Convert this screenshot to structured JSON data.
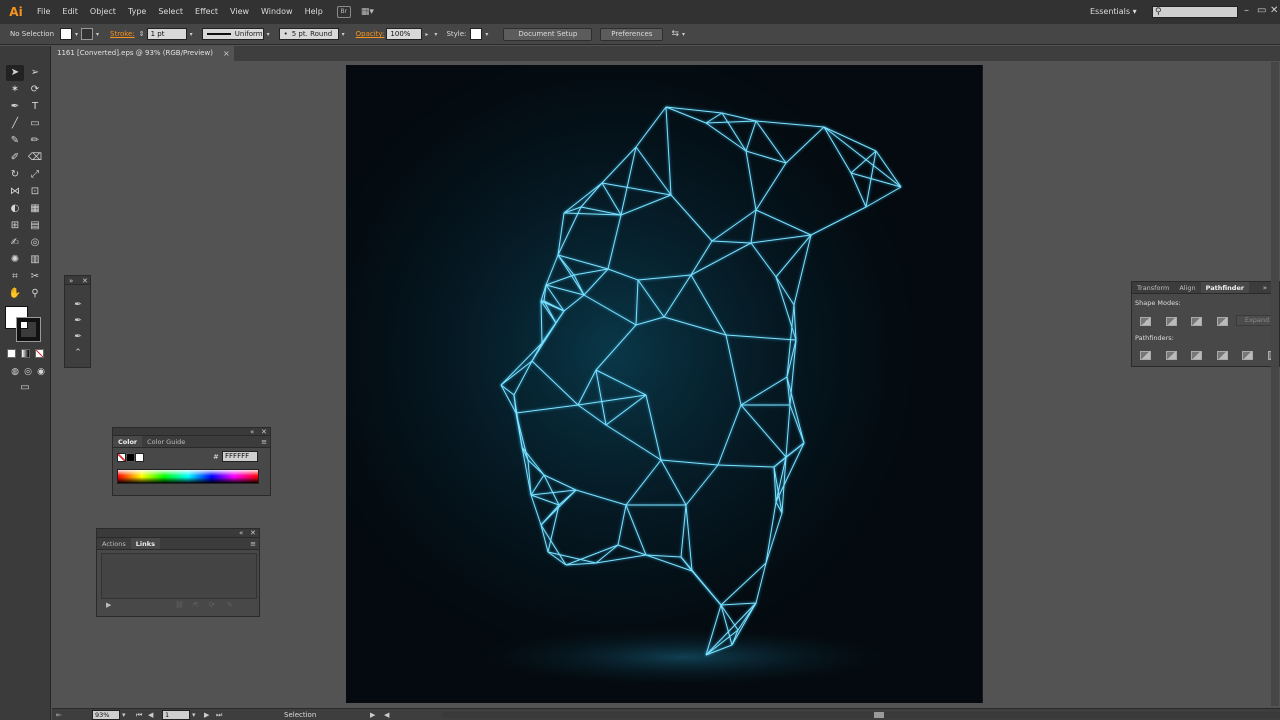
{
  "app": {
    "logo": "Ai"
  },
  "menus": [
    "File",
    "Edit",
    "Object",
    "Type",
    "Select",
    "Effect",
    "View",
    "Window",
    "Help"
  ],
  "menubar": {
    "bridge_label": "Br",
    "workspace": "Essentials",
    "workspace_arrow": "▾",
    "search_placeholder": "",
    "window_controls": [
      "–",
      "▭",
      "✕"
    ]
  },
  "controlbar": {
    "selection": "No Selection",
    "stroke_label": "Stroke:",
    "stroke_weight": "1 pt",
    "stroke_profile": "Uniform",
    "brush": "5 pt. Round",
    "opacity_label": "Opacity:",
    "opacity_value": "100%",
    "style_label": "Style:",
    "document_setup": "Document Setup",
    "preferences": "Preferences"
  },
  "document": {
    "tab_title": "1161 [Converted].eps @ 93% (RGB/Preview)",
    "close": "×"
  },
  "tools_panel": {
    "tools": [
      {
        "name": "selection-tool",
        "glyph": "➤"
      },
      {
        "name": "direct-selection-tool",
        "glyph": "➢"
      },
      {
        "name": "magic-wand-tool",
        "glyph": "✶"
      },
      {
        "name": "lasso-tool",
        "glyph": "⟳"
      },
      {
        "name": "pen-tool",
        "glyph": "✒"
      },
      {
        "name": "type-tool",
        "glyph": "T"
      },
      {
        "name": "line-tool",
        "glyph": "╱"
      },
      {
        "name": "rectangle-tool",
        "glyph": "▭"
      },
      {
        "name": "paintbrush-tool",
        "glyph": "✎"
      },
      {
        "name": "pencil-tool",
        "glyph": "✏"
      },
      {
        "name": "blob-brush-tool",
        "glyph": "✐"
      },
      {
        "name": "eraser-tool",
        "glyph": "⌫"
      },
      {
        "name": "rotate-tool",
        "glyph": "↻"
      },
      {
        "name": "scale-tool",
        "glyph": "⤢"
      },
      {
        "name": "width-tool",
        "glyph": "⋈"
      },
      {
        "name": "free-transform-tool",
        "glyph": "⊡"
      },
      {
        "name": "shape-builder-tool",
        "glyph": "◐"
      },
      {
        "name": "perspective-grid-tool",
        "glyph": "▦"
      },
      {
        "name": "mesh-tool",
        "glyph": "⊞"
      },
      {
        "name": "gradient-tool",
        "glyph": "▤"
      },
      {
        "name": "eyedropper-tool",
        "glyph": "✍"
      },
      {
        "name": "blend-tool",
        "glyph": "◎"
      },
      {
        "name": "symbol-sprayer-tool",
        "glyph": "✺"
      },
      {
        "name": "column-graph-tool",
        "glyph": "▥"
      },
      {
        "name": "artboard-tool",
        "glyph": "⌗"
      },
      {
        "name": "slice-tool",
        "glyph": "✂"
      },
      {
        "name": "hand-tool",
        "glyph": "✋"
      },
      {
        "name": "zoom-tool",
        "glyph": "⚲"
      }
    ]
  },
  "pen_flyout": {
    "tools": [
      "✒",
      "✒",
      "✒",
      "⌃"
    ]
  },
  "color_panel": {
    "tabs": [
      "Color",
      "Color Guide"
    ],
    "active_tab": "Color",
    "hex_label": "#",
    "hex_value": "FFFFFF",
    "colors": {
      "none_stroke": "#d33",
      "black": "#000000",
      "white": "#ffffff"
    }
  },
  "links_panel": {
    "tabs": [
      "Actions",
      "Links"
    ],
    "active_tab": "Links"
  },
  "pathfinder_panel": {
    "tabs": [
      "Transform",
      "Align",
      "Pathfinder"
    ],
    "active_tab": "Pathfinder",
    "shape_modes_label": "Shape Modes:",
    "expand_label": "Expand",
    "pathfinders_label": "Pathfinders:"
  },
  "statusbar": {
    "zoom": "93%",
    "artboard_number": "1",
    "tool_name": "Selection"
  },
  "colors": {
    "accent_orange": "#f7931e",
    "artboard_bg": "#040a0f",
    "mesh_line": "#7fe3ff",
    "panel_bg": "#484848",
    "workspace_bg": "#535353"
  }
}
